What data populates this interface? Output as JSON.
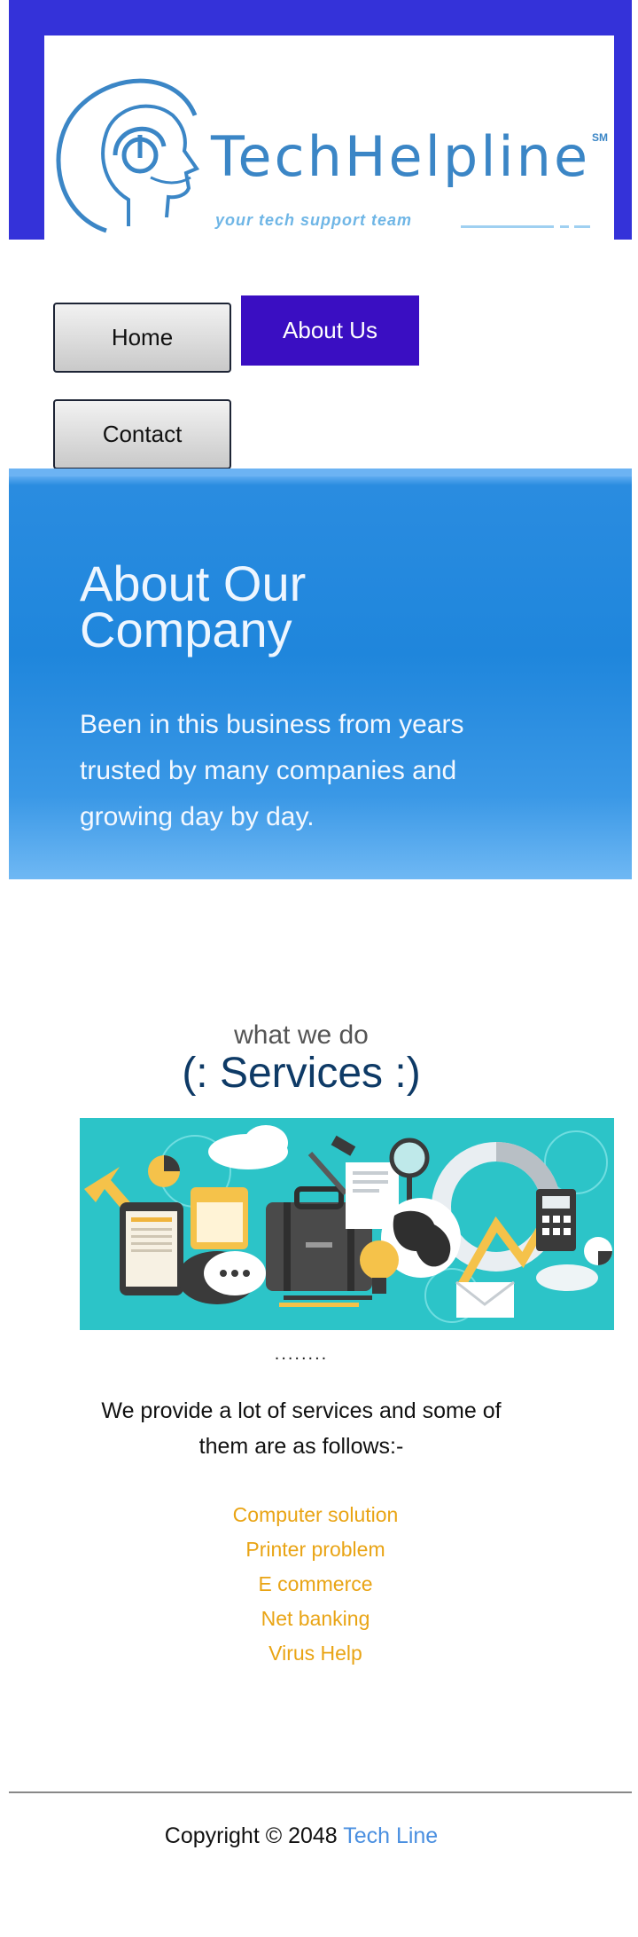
{
  "logo": {
    "word": "TechHelpline",
    "mark": "SM",
    "tagline": "your tech support team",
    "icon": "headset-head-icon"
  },
  "nav": {
    "items": [
      {
        "label": "Home"
      },
      {
        "label": "About Us"
      },
      {
        "label": "Contact"
      }
    ]
  },
  "hero": {
    "title": "About Our Company",
    "text": "Been in this business from years trusted by many companies and growing day by day."
  },
  "services": {
    "subtitle": "what we do",
    "title": "(: Services :)",
    "image_icon": "office-services-illustration",
    "dots": "........",
    "intro": "We provide a lot of services and some of them are as follows:-",
    "items": [
      "Computer solution",
      "Printer problem",
      "E commerce",
      "Net banking",
      "Virus Help"
    ]
  },
  "footer": {
    "copyright": "Copyright © 2048",
    "brand": "Tech Line"
  },
  "colors": {
    "header_band": "#3432d9",
    "nav_active": "#3a0ec2",
    "hero_blue": "#1f86dc",
    "service_link": "#e9a414",
    "footer_link": "#4a8fe0"
  }
}
